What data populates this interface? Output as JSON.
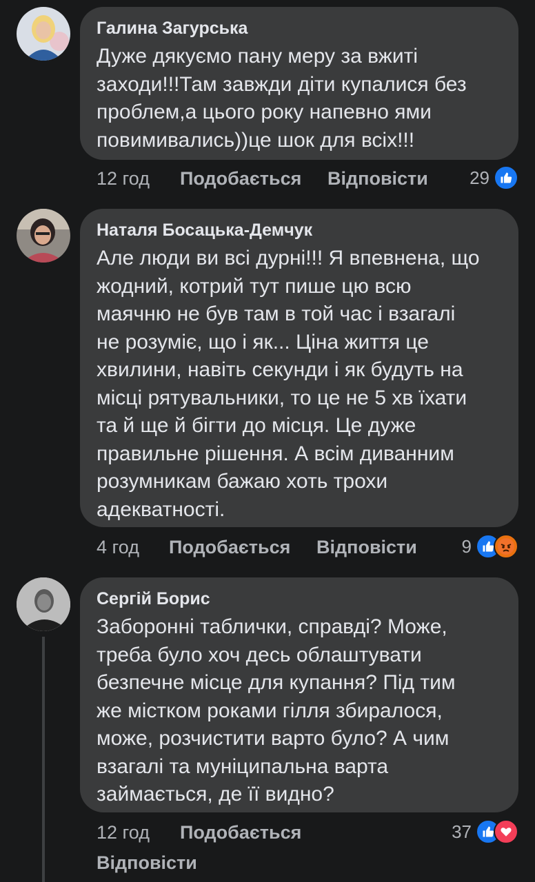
{
  "colors": {
    "background": "#18191a",
    "bubble": "#3a3b3c",
    "muted": "#b0b3b8",
    "like_blue": "#1877f2",
    "angry_orange": "#e9710f",
    "love_red": "#f33e58"
  },
  "comments": [
    {
      "author": "Галина Загурська",
      "text": "Дуже дякуємо пану меру за вжиті\nзаходи!!!Там завжди діти купалися без\nпроблем,а цього року напевно ями\nповимивались))це шок для всіх!!!",
      "time": "12 год",
      "like_label": "Подобається",
      "reply_label": "Відповісти",
      "reaction_count": "29",
      "reactions": [
        "like-icon"
      ]
    },
    {
      "author": "Наталя Босацька-Демчук",
      "text": "Але люди ви всі дурні!!! Я впевнена, що\nжодний, котрий тут пише цю всю\nмаячню не був там в той час і взагалі\nне розуміє, що і як... Ціна життя це\nхвилини, навіть секунди і як будуть на\nмісці рятувальники, то це не 5 хв  їхати\nта й ще й бігти до місця. Це дуже\nправильне рішення. А всім диванним\nрозумникам бажаю хоть трохи\nадекватності.",
      "time": "4 год",
      "like_label": "Подобається",
      "reply_label": "Відповісти",
      "reaction_count": "9",
      "reactions": [
        "like-icon",
        "angry-icon"
      ]
    },
    {
      "author": "Сергій Борис",
      "text": "Заборонні таблички, справді? Може,\nтреба було хоч десь облаштувати\nбезпечне місце для купання? Під тим\nже містком роками гілля збиралося,\nможе, розчистити варто було? А чим\nвзагалі та муніципальна варта\nзаймається, де її видно?",
      "time": "12 год",
      "like_label": "Подобається",
      "reply_label": "Відповісти",
      "reaction_count": "37",
      "reactions": [
        "like-icon",
        "love-icon"
      ]
    }
  ]
}
